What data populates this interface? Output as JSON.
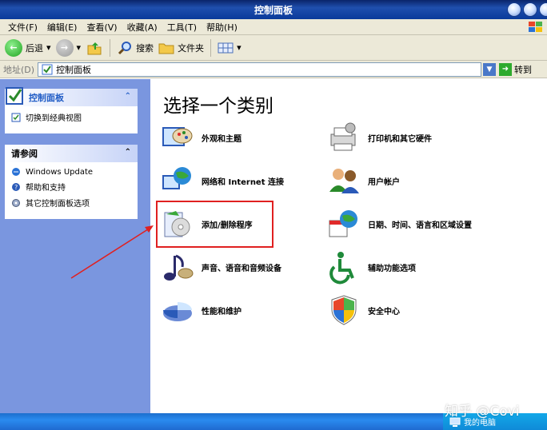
{
  "window": {
    "title": "控制面板"
  },
  "menu": [
    "文件(F)",
    "编辑(E)",
    "查看(V)",
    "收藏(A)",
    "工具(T)",
    "帮助(H)"
  ],
  "toolbar": {
    "back": "后退",
    "search": "搜索",
    "folders": "文件夹"
  },
  "address": {
    "label": "地址(D)",
    "value": "控制面板",
    "go": "转到"
  },
  "left": {
    "panel1": {
      "title": "控制面板",
      "switch_link": "切换到经典视图"
    },
    "panel2": {
      "title": "请参阅",
      "links": [
        "Windows Update",
        "帮助和支持",
        "其它控制面板选项"
      ]
    }
  },
  "main": {
    "heading": "选择一个类别",
    "categories": [
      "外观和主题",
      "打印机和其它硬件",
      "网络和 Internet 连接",
      "用户帐户",
      "添加/删除程序",
      "日期、时间、语言和区域设置",
      "声音、语音和音频设备",
      "辅助功能选项",
      "性能和维护",
      "安全中心"
    ]
  },
  "taskbar": {
    "tray_label": "我的电脑"
  },
  "watermark": "知乎 @Covi",
  "colors": {
    "titlebar": "#1f4fae",
    "leftpane": "#7a96df",
    "highlight": "#e02020",
    "taskbar": "#2a8bef"
  }
}
